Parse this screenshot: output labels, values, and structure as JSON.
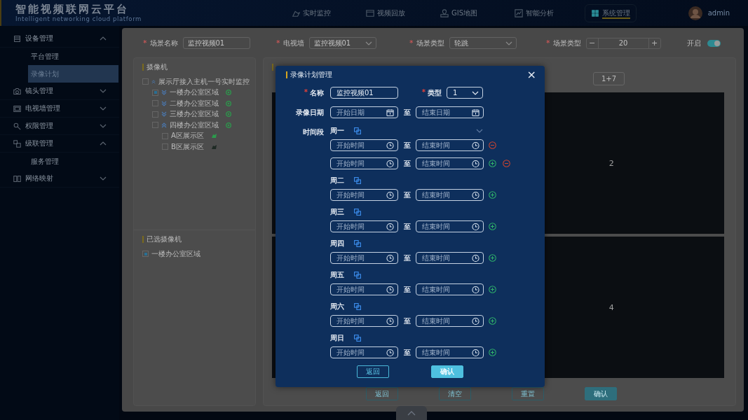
{
  "header": {
    "title": "智能视频联网云平台",
    "subtitle": "Intelligent networking cloud platform",
    "nav": [
      {
        "label": "实时监控",
        "selected": false
      },
      {
        "label": "视频回放",
        "selected": false
      },
      {
        "label": "GIS地图",
        "selected": false
      },
      {
        "label": "智能分析",
        "selected": false
      },
      {
        "label": "系统管理",
        "selected": true
      }
    ],
    "user": "admin"
  },
  "sidebar": {
    "items": [
      {
        "label": "设备管理",
        "expanded": true,
        "children": [
          {
            "label": "平台管理",
            "selected": false
          },
          {
            "label": "录像计划",
            "selected": true
          }
        ]
      },
      {
        "label": "镜头管理",
        "expanded": false
      },
      {
        "label": "电视墙管理",
        "expanded": false
      },
      {
        "label": "权限管理",
        "expanded": false
      },
      {
        "label": "级联管理",
        "expanded": true,
        "children": [
          {
            "label": "服务管理",
            "selected": false
          }
        ]
      },
      {
        "label": "网络映射",
        "expanded": false
      }
    ]
  },
  "form": {
    "fields": [
      {
        "kind": "input",
        "required": "*",
        "label": "场景名称",
        "value": "监控视频01"
      },
      {
        "kind": "select",
        "required": "*",
        "label": "电视墙",
        "value": "监控视频01"
      },
      {
        "kind": "select",
        "required": "*",
        "label": "场景类型",
        "value": "轮跳"
      },
      {
        "kind": "stepper",
        "required": "*",
        "label": "场景类型",
        "value": "20",
        "minus": "−",
        "plus": "+"
      }
    ],
    "toggle": {
      "label": "开启",
      "on": true
    }
  },
  "cameras": {
    "title": "摄像机",
    "tree": [
      {
        "label": "展示厅接入主机一号实时监控",
        "checked": false,
        "expanded": true,
        "children": [
          {
            "label": "一楼办公室区域",
            "checked": true,
            "expanded": false,
            "color": "#2c9a4c"
          },
          {
            "label": "二楼办公室区域",
            "checked": false,
            "expanded": false,
            "color": "#2c9a4c"
          },
          {
            "label": "三楼办公室区域",
            "checked": false,
            "expanded": false,
            "color": "#2c9a4c"
          },
          {
            "label": "四楼办公室区域",
            "checked": false,
            "expanded": true,
            "color": "#2c9a4c",
            "children": [
              {
                "label": "A区展示区",
                "checked": false,
                "color": "#2c9a4c"
              },
              {
                "label": "B区展示区",
                "checked": false,
                "color": "#1e2a24"
              }
            ]
          }
        ]
      }
    ]
  },
  "selected_cameras": {
    "title": "已选摄像机",
    "items": [
      {
        "label": "一楼办公室区域",
        "checked": true
      }
    ]
  },
  "tv_wall": {
    "layouts": [
      {
        "label": "1+7",
        "selected": false
      }
    ],
    "screens": [
      {
        "kind": "screen"
      },
      {
        "kind": "screen",
        "label": "2"
      },
      {
        "kind": "screen"
      },
      {
        "kind": "screen",
        "label": "4"
      }
    ],
    "buttons": [
      {
        "label": "返回",
        "primary": false
      },
      {
        "label": "清空",
        "primary": false
      },
      {
        "label": "重置",
        "primary": false
      },
      {
        "label": "确认",
        "primary": true
      }
    ]
  },
  "modal": {
    "title": "录像计划管理",
    "close": "×",
    "name": {
      "required": "*",
      "label": "名称",
      "value": "监控视频01"
    },
    "type": {
      "required": "*",
      "label": "类型",
      "value": "1"
    },
    "date": {
      "label": "录像日期",
      "start_placeholder": "开始日期",
      "to": "至",
      "end_placeholder": "结束日期"
    },
    "schedule": {
      "label": "时间段",
      "expanded": true,
      "days": [
        {
          "label": "周一",
          "slots": [
            {
              "start_placeholder": "开始时间",
              "to": "至",
              "end_placeholder": "结束时间",
              "add": false,
              "remove": true
            },
            {
              "start_placeholder": "开始时间",
              "to": "至",
              "end_placeholder": "结束时间",
              "add": true,
              "remove": true
            }
          ]
        },
        {
          "label": "周二",
          "slots": [
            {
              "start_placeholder": "开始时间",
              "to": "至",
              "end_placeholder": "结束时间",
              "add": true,
              "remove": false
            }
          ]
        },
        {
          "label": "周三",
          "slots": [
            {
              "start_placeholder": "开始时间",
              "to": "至",
              "end_placeholder": "结束时间",
              "add": true,
              "remove": false
            }
          ]
        },
        {
          "label": "周四",
          "slots": [
            {
              "start_placeholder": "开始时间",
              "to": "至",
              "end_placeholder": "结束时间",
              "add": true,
              "remove": false
            }
          ]
        },
        {
          "label": "周五",
          "slots": [
            {
              "start_placeholder": "开始时间",
              "to": "至",
              "end_placeholder": "结束时间",
              "add": true,
              "remove": false
            }
          ]
        },
        {
          "label": "周六",
          "slots": [
            {
              "start_placeholder": "开始时间",
              "to": "至",
              "end_placeholder": "结束时间",
              "add": true,
              "remove": false
            }
          ]
        },
        {
          "label": "周日",
          "slots": [
            {
              "start_placeholder": "开始时间",
              "to": "至",
              "end_placeholder": "结束时间",
              "add": true,
              "remove": false
            }
          ]
        }
      ]
    },
    "buttons": [
      {
        "label": "返回",
        "primary": false
      },
      {
        "label": "确认",
        "primary": true
      }
    ]
  }
}
